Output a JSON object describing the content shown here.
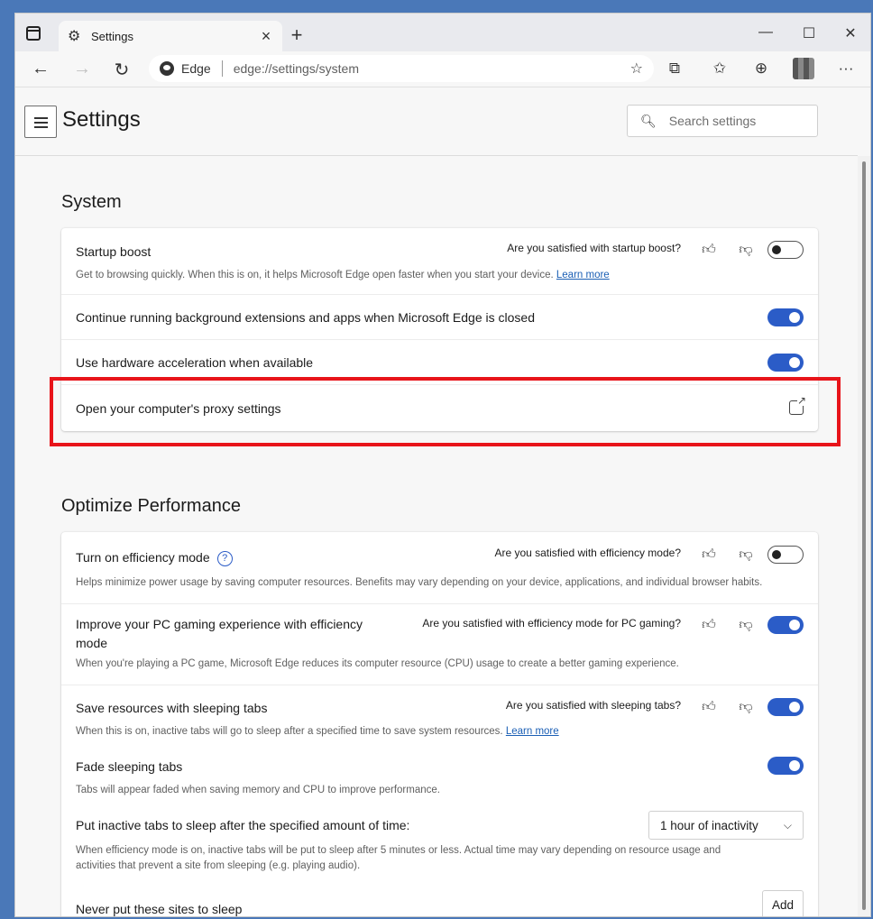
{
  "tab": {
    "title": "Settings",
    "close": "×",
    "new_tab": "+"
  },
  "window_controls": {
    "minimize": "—",
    "maximize": "☐",
    "close": "✕"
  },
  "nav": {
    "back": "←",
    "forward": "→",
    "refresh": "↻"
  },
  "address": {
    "brand": "Edge",
    "url": "edge://settings/system"
  },
  "toolbar_icons": {
    "favorite": "☆",
    "extensions": "⧉",
    "favorites_bar": "✩",
    "collections": "⊕",
    "more": "···"
  },
  "header": {
    "title": "Settings",
    "search_placeholder": "Search settings"
  },
  "system": {
    "title": "System",
    "startup_boost": {
      "title": "Startup boost",
      "feedback": "Are you satisfied with startup boost?",
      "desc": "Get to browsing quickly. When this is on, it helps Microsoft Edge open faster when you start your device.",
      "link": "Learn more",
      "enabled": false
    },
    "background": {
      "title": "Continue running background extensions and apps when Microsoft Edge is closed",
      "enabled": true
    },
    "hardware": {
      "title": "Use hardware acceleration when available",
      "enabled": true
    },
    "proxy": {
      "title": "Open your computer's proxy settings"
    }
  },
  "performance": {
    "title": "Optimize Performance",
    "efficiency": {
      "title": "Turn on efficiency mode",
      "help": "?",
      "feedback": "Are you satisfied with efficiency mode?",
      "desc": "Helps minimize power usage by saving computer resources. Benefits may vary depending on your device, applications, and individual browser habits.",
      "enabled": false
    },
    "gaming": {
      "title_line1": "Improve your PC gaming experience with efficiency",
      "title_line2": "mode",
      "feedback": "Are you satisfied with efficiency mode for PC gaming?",
      "desc": "When you're playing a PC game, Microsoft Edge reduces its computer resource (CPU) usage to create a better gaming experience.",
      "enabled": true
    },
    "sleeping": {
      "title": "Save resources with sleeping tabs",
      "feedback": "Are you satisfied with sleeping tabs?",
      "desc": "When this is on, inactive tabs will go to sleep after a specified time to save system resources.",
      "link": "Learn more",
      "enabled": true
    },
    "fade": {
      "title": "Fade sleeping tabs",
      "desc": "Tabs will appear faded when saving memory and CPU to improve performance.",
      "enabled": true
    },
    "inactive": {
      "title": "Put inactive tabs to sleep after the specified amount of time:",
      "selected": "1 hour of inactivity",
      "desc_line1": "When efficiency mode is on, inactive tabs will be put to sleep after 5 minutes or less. Actual time may vary depending on resource usage and",
      "desc_line2": "activities that prevent a site from sleeping (e.g. playing audio)."
    },
    "never_sleep": {
      "title": "Never put these sites to sleep",
      "add_label": "Add"
    }
  },
  "colors": {
    "accent": "#2b5cc7",
    "highlight": "#e8141a",
    "link": "#1b5fb5"
  }
}
